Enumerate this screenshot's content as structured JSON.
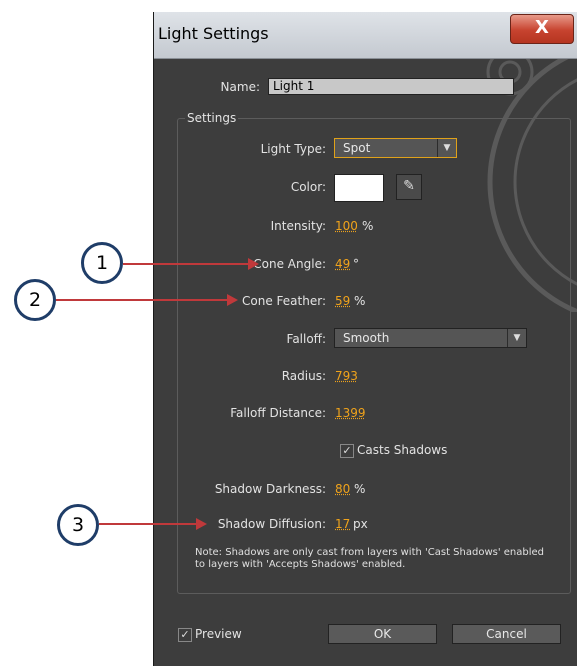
{
  "dialog": {
    "title": "Light Settings",
    "close_label": "X",
    "name_label": "Name:",
    "name_value": "Light 1",
    "settings_label": "Settings",
    "light_type": {
      "label": "Light Type:",
      "value": "Spot"
    },
    "color_label": "Color:",
    "intensity": {
      "label": "Intensity:",
      "value": "100",
      "unit": "%"
    },
    "cone_angle": {
      "label": "Cone Angle:",
      "value": "49",
      "unit": "°"
    },
    "cone_feather": {
      "label": "Cone Feather:",
      "value": "59",
      "unit": "%"
    },
    "falloff": {
      "label": "Falloff:",
      "value": "Smooth"
    },
    "radius": {
      "label": "Radius:",
      "value": "793"
    },
    "falloff_distance": {
      "label": "Falloff Distance:",
      "value": "1399"
    },
    "casts_shadows": {
      "label": "Casts Shadows",
      "checked": true
    },
    "shadow_darkness": {
      "label": "Shadow Darkness:",
      "value": "80",
      "unit": "%"
    },
    "shadow_diffusion": {
      "label": "Shadow Diffusion:",
      "value": "17",
      "unit": "px"
    },
    "note": "Note: Shadows are only cast from layers with 'Cast Shadows' enabled to layers with 'Accepts Shadows' enabled.",
    "preview": {
      "label": "Preview",
      "checked": true
    },
    "ok_label": "OK",
    "cancel_label": "Cancel"
  },
  "callouts": [
    "1",
    "2",
    "3"
  ],
  "colors": {
    "accent_value": "#f0a31b",
    "arrow": "#c0393b",
    "callout_border": "#1f3d68"
  }
}
